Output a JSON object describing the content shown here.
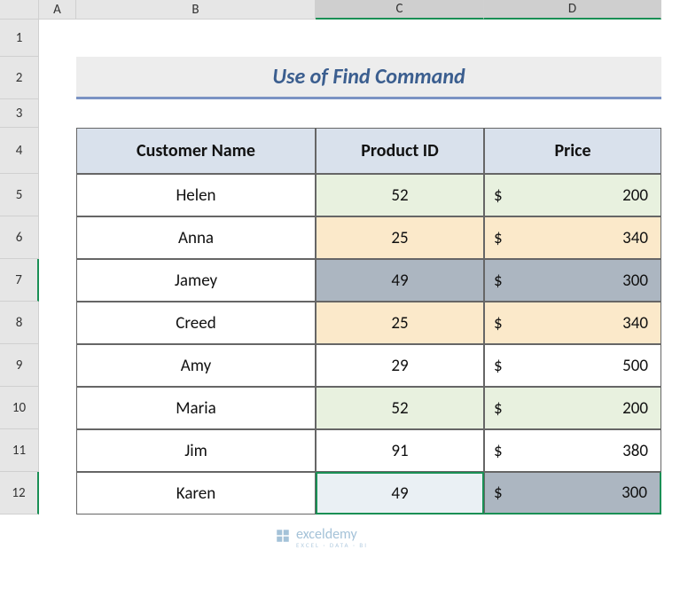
{
  "columns": [
    "A",
    "B",
    "C",
    "D"
  ],
  "rows": [
    "1",
    "2",
    "3",
    "4",
    "5",
    "6",
    "7",
    "8",
    "9",
    "10",
    "11",
    "12"
  ],
  "title": "Use of Find Command",
  "headers": {
    "customer": "Customer Name",
    "product": "Product ID",
    "price": "Price"
  },
  "currency": "$",
  "data": [
    {
      "name": "Helen",
      "product": "52",
      "price": "200",
      "cclass": "green",
      "pclass": "green"
    },
    {
      "name": "Anna",
      "product": "25",
      "price": "340",
      "cclass": "orange",
      "pclass": "orange"
    },
    {
      "name": "Jamey",
      "product": "49",
      "price": "300",
      "cclass": "gray",
      "pclass": "gray"
    },
    {
      "name": "Creed",
      "product": "25",
      "price": "340",
      "cclass": "orange",
      "pclass": "orange"
    },
    {
      "name": "Amy",
      "product": "29",
      "price": "500",
      "cclass": "",
      "pclass": ""
    },
    {
      "name": "Maria",
      "product": "52",
      "price": "200",
      "cclass": "green",
      "pclass": "green"
    },
    {
      "name": "Jim",
      "product": "91",
      "price": "380",
      "cclass": "",
      "pclass": ""
    },
    {
      "name": "Karen",
      "product": "49",
      "price": "300",
      "cclass": "selC12",
      "pclass": "gray selD12"
    }
  ],
  "watermark": {
    "brand": "exceldemy",
    "sub": "EXCEL · DATA · BI"
  }
}
